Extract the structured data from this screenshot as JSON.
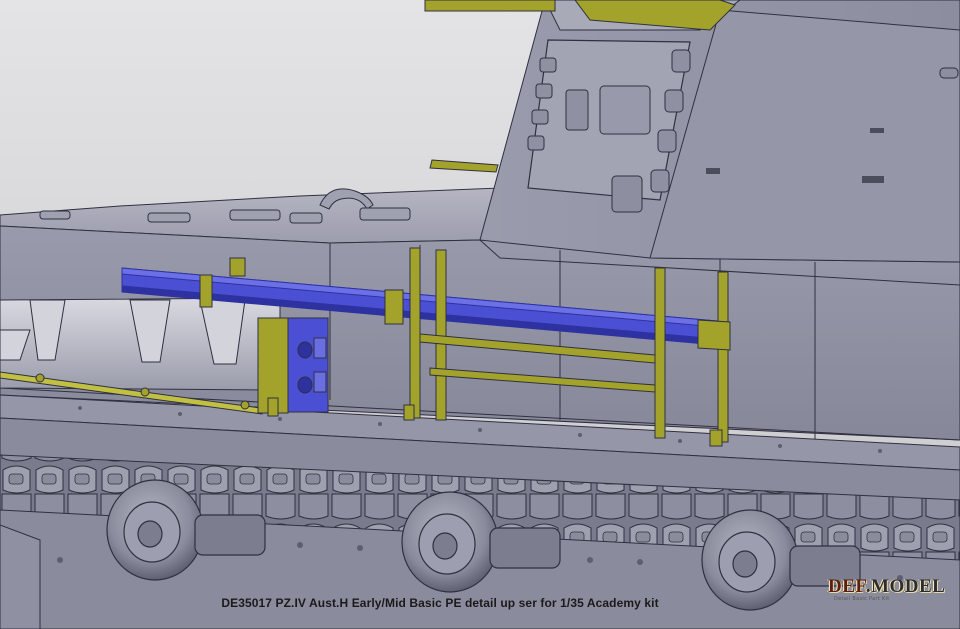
{
  "caption": "DE35017 PZ.IV Aust.H Early/Mid Basic PE detail up ser for 1/35 Academy kit",
  "logo": {
    "brand_prefix": "DEF",
    "brand_main": "MODEL",
    "tagline": "Detail Basic Part Kit"
  },
  "colors": {
    "background_sky": "#c9c9cc",
    "hull_gray": "#8d8fa1",
    "hull_light": "#a3a5b4",
    "hull_dark": "#6d6f80",
    "pe_brass": "#a3a32c",
    "pe_brass_light": "#c2c043",
    "rail_blue": "#4b4fd3",
    "rail_blue_dark": "#2e32a0",
    "edge_line": "#2f3040"
  }
}
